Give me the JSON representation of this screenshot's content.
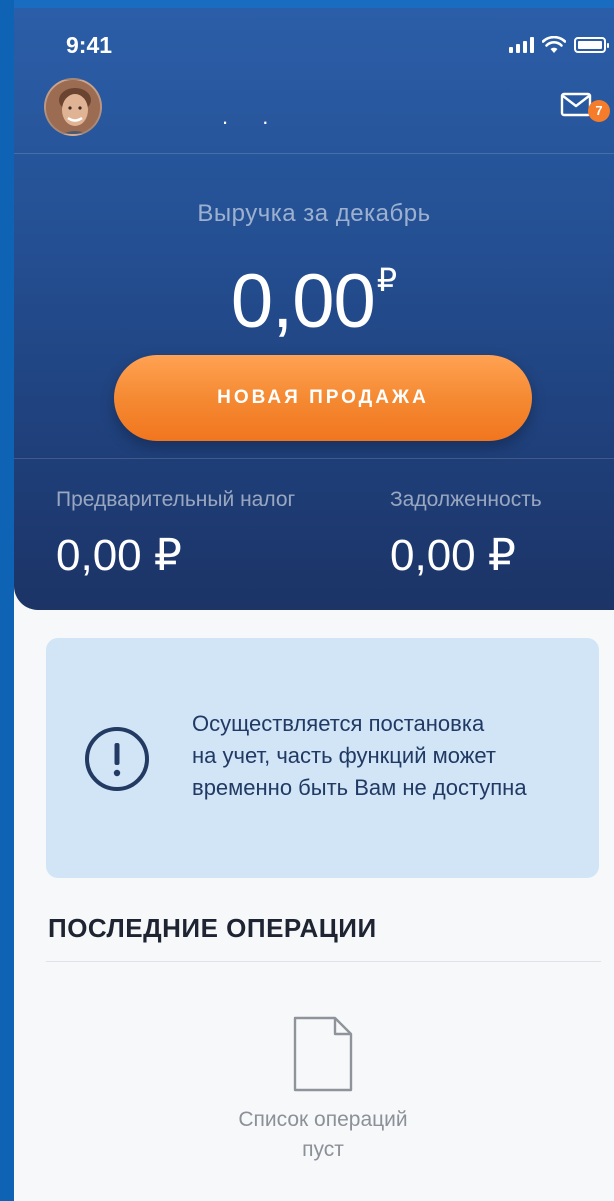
{
  "status_bar": {
    "time": "9:41"
  },
  "header": {
    "title_dots": ". .",
    "unread_count": "7"
  },
  "revenue": {
    "label": "Выручка за декабрь",
    "amount": "0,00",
    "currency": "₽"
  },
  "actions": {
    "new_sale_label": "НОВАЯ ПРОДАЖА"
  },
  "stats": {
    "tax_label": "Предварительный налог",
    "tax_value": "0,00 ₽",
    "debt_label": "Задолженность",
    "debt_value": "0,00 ₽"
  },
  "notice": {
    "line1": "Осуществляется постановка",
    "line2": "на учет, часть функций может",
    "line3": "временно быть Вам не доступна"
  },
  "operations": {
    "title": "ПОСЛЕДНИЕ ОПЕРАЦИИ",
    "empty_line1": "Список операций",
    "empty_line2": "пуст"
  },
  "colors": {
    "accent_orange": "#f58a33",
    "hero_blue": "#244f92",
    "notice_bg": "#d1e5f6"
  }
}
